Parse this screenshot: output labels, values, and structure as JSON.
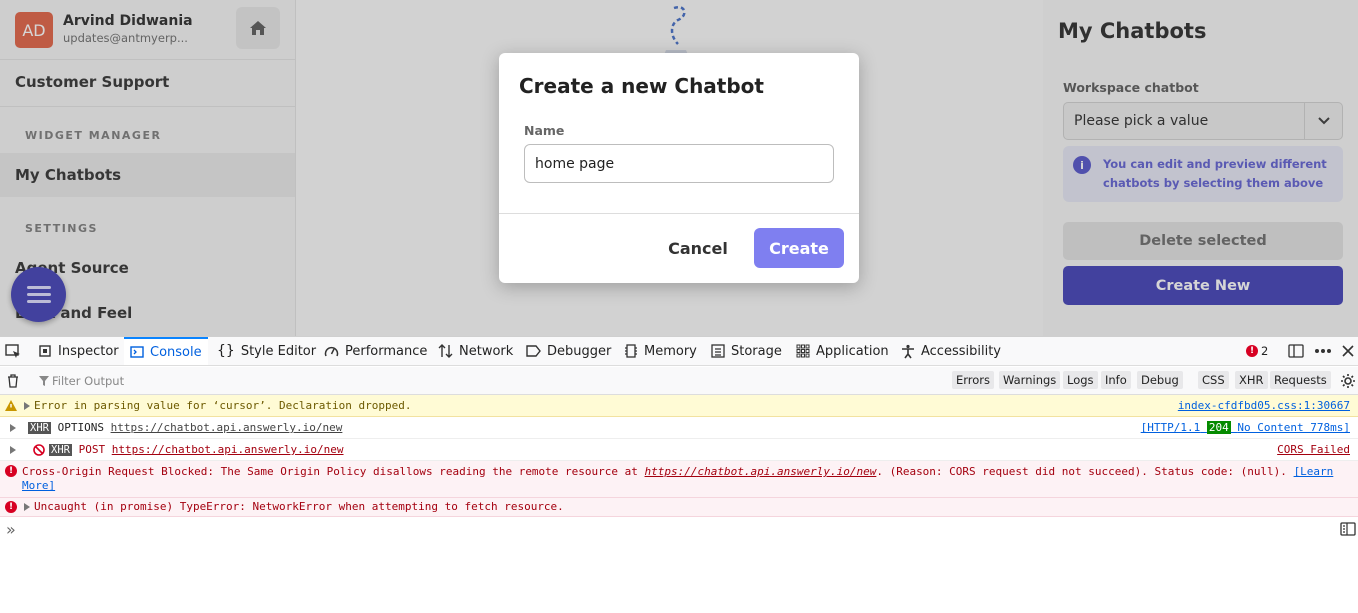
{
  "user": {
    "initials": "AD",
    "name": "Arvind Didwania",
    "email": "updates@antmyerp..."
  },
  "sidebar": {
    "top_item": "Customer Support",
    "section_widget": "WIDGET MANAGER",
    "active_item": "My Chatbots",
    "section_settings": "SETTINGS",
    "item_agent_source": "Agent Source",
    "item_look_feel": "Look and Feel"
  },
  "right_panel": {
    "title": "My Chatbots",
    "workspace_label": "Workspace chatbot",
    "select_value": "Please pick a value",
    "info_text": "You can edit and preview different chatbots by selecting them above",
    "delete_button": "Delete selected",
    "create_new_button": "Create New"
  },
  "modal": {
    "title": "Create a new Chatbot",
    "name_label": "Name",
    "name_value": "home page",
    "cancel": "Cancel",
    "create": "Create"
  },
  "devtools": {
    "tabs": [
      "Inspector",
      "Console",
      "Style Editor",
      "Performance",
      "Network",
      "Debugger",
      "Memory",
      "Storage",
      "Application",
      "Accessibility"
    ],
    "active_tab": "Console",
    "error_count": "2",
    "filter_placeholder": "Filter Output",
    "filter_buttons": [
      "Errors",
      "Warnings",
      "Logs",
      "Info",
      "Debug",
      "CSS",
      "XHR",
      "Requests"
    ],
    "messages": {
      "warn_text": "Error in parsing value for ‘cursor’.  Declaration dropped.",
      "warn_source": "index-cfdfbd05.css:1:30667",
      "xhr_badge": "XHR",
      "options_method": "OPTIONS",
      "options_url": "https://chatbot.api.answerly.io/new",
      "options_http": "[HTTP/1.1",
      "options_status": "204",
      "options_rest": "No Content 778ms]",
      "post_method": "POST",
      "post_url": "https://chatbot.api.answerly.io/new",
      "post_result": "CORS Failed",
      "cors_prefix": "Cross-Origin Request Blocked: The Same Origin Policy disallows reading the remote resource at ",
      "cors_url": "https://chatbot.api.answerly.io/new",
      "cors_suffix": ". (Reason: CORS request did not succeed). Status code: (null). ",
      "cors_learn_1": "[Learn",
      "cors_learn_2": "More]",
      "uncaught_text": "Uncaught (in promise) TypeError: NetworkError when attempting to fetch resource."
    },
    "prompt": "»"
  },
  "colors": {
    "brand": "#3a39b4",
    "create_btn": "#7f7ff0",
    "avatar": "#e05b3c",
    "error": "#d70022"
  }
}
